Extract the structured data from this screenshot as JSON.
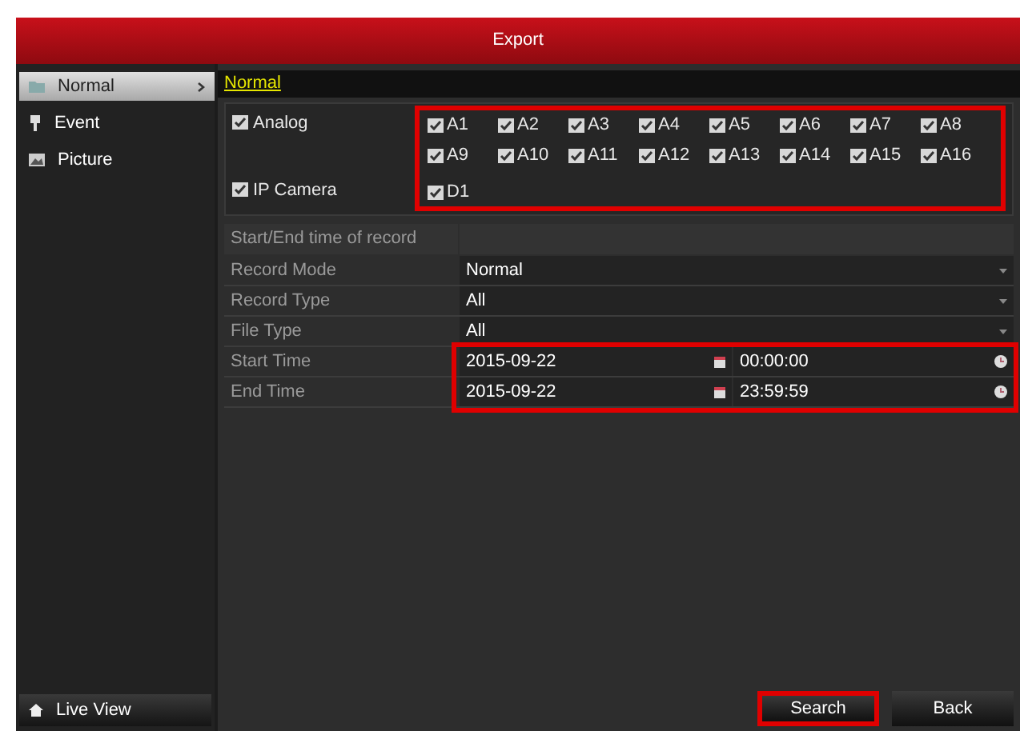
{
  "window": {
    "title": "Export"
  },
  "sidebar": {
    "items": [
      {
        "label": "Normal",
        "selected": true,
        "kind": "folder"
      },
      {
        "label": "Event",
        "selected": false,
        "kind": "pin"
      },
      {
        "label": "Picture",
        "selected": false,
        "kind": "image"
      }
    ],
    "footer": "Live View"
  },
  "section_title": "Normal",
  "channels": {
    "highlighted": true,
    "groups": [
      {
        "label": "Analog",
        "checked": true,
        "items": [
          {
            "label": "A1",
            "checked": true
          },
          {
            "label": "A2",
            "checked": true
          },
          {
            "label": "A3",
            "checked": true
          },
          {
            "label": "A4",
            "checked": true
          },
          {
            "label": "A5",
            "checked": true
          },
          {
            "label": "A6",
            "checked": true
          },
          {
            "label": "A7",
            "checked": true
          },
          {
            "label": "A8",
            "checked": true
          },
          {
            "label": "A9",
            "checked": true
          },
          {
            "label": "A10",
            "checked": true
          },
          {
            "label": "A11",
            "checked": true
          },
          {
            "label": "A12",
            "checked": true
          },
          {
            "label": "A13",
            "checked": true
          },
          {
            "label": "A14",
            "checked": true
          },
          {
            "label": "A15",
            "checked": true
          },
          {
            "label": "A16",
            "checked": true
          }
        ]
      },
      {
        "label": "IP Camera",
        "checked": true,
        "items": [
          {
            "label": "D1",
            "checked": true
          }
        ]
      }
    ]
  },
  "form": {
    "section_label": "Start/End time of record",
    "fields": [
      {
        "label": "Record Mode",
        "value": "Normal"
      },
      {
        "label": "Record Type",
        "value": "All"
      },
      {
        "label": "File Type",
        "value": "All"
      }
    ],
    "times_highlighted": true,
    "times": [
      {
        "label": "Start Time",
        "date": "2015-09-22",
        "time": "00:00:00"
      },
      {
        "label": "End Time",
        "date": "2015-09-22",
        "time": "23:59:59"
      }
    ]
  },
  "buttons": [
    {
      "label": "Search",
      "highlighted": true
    },
    {
      "label": "Back",
      "highlighted": false
    }
  ]
}
